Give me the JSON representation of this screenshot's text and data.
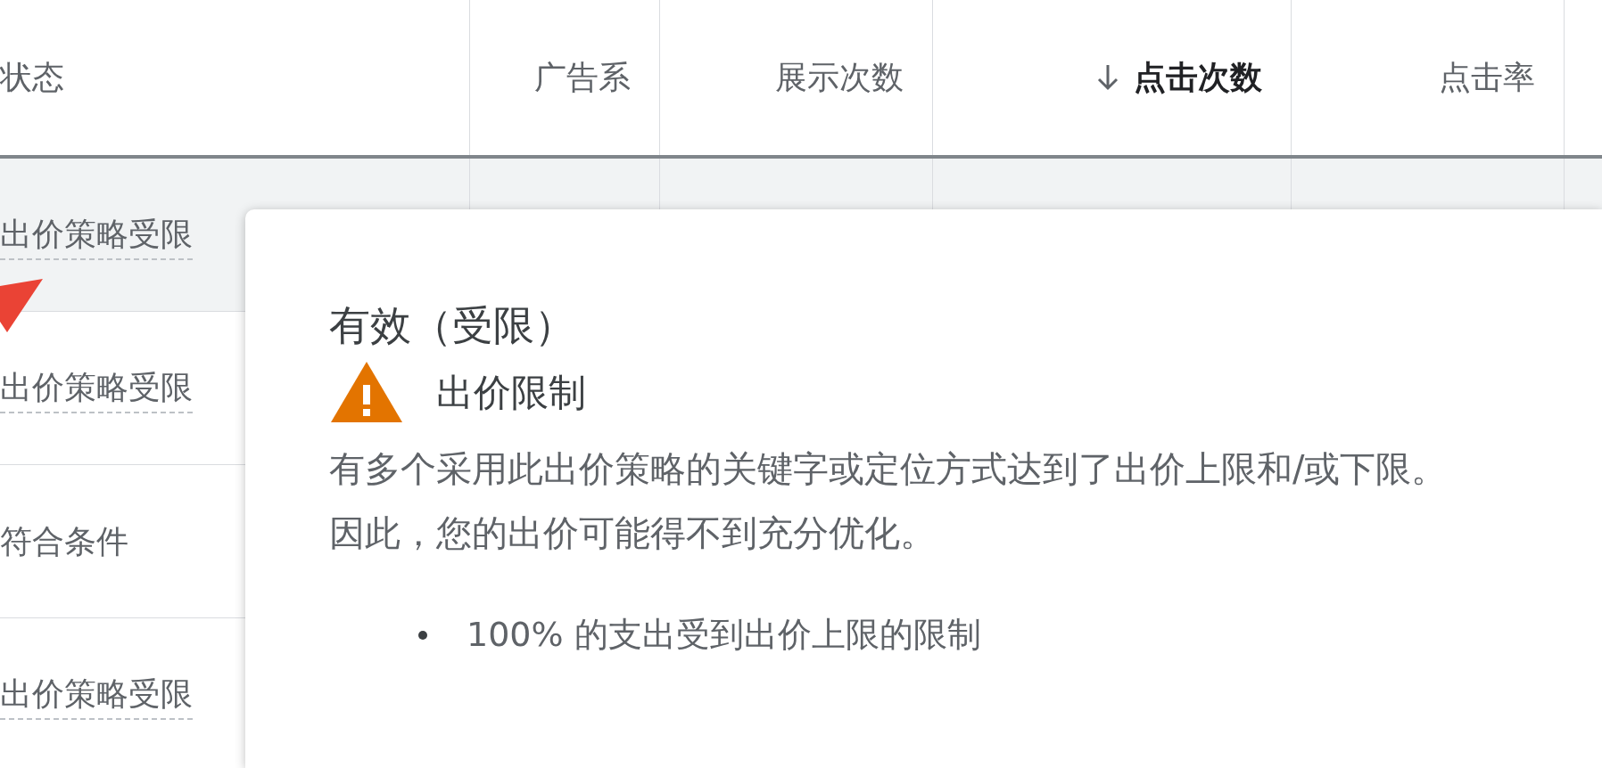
{
  "table": {
    "columns": [
      {
        "label": "状态",
        "sorted": false
      },
      {
        "label": "广告系",
        "sorted": false
      },
      {
        "label": "展示次数",
        "sorted": false
      },
      {
        "label": "点击次数",
        "sorted": true
      },
      {
        "label": "点击率",
        "sorted": false
      }
    ],
    "rows": [
      {
        "status": "出价策略受限",
        "kind": "limited",
        "hovered": true
      },
      {
        "status": "出价策略受限",
        "kind": "limited",
        "hovered": false
      },
      {
        "status": "符合条件",
        "kind": "plain",
        "hovered": false
      },
      {
        "status": "出价策略受限",
        "kind": "limited",
        "hovered": false
      }
    ]
  },
  "tooltip": {
    "title": "有效（受限）",
    "warning": "出价限制",
    "description": "有多个采用此出价策略的关键字或定位方式达到了出价上限和/或下限。因此，您的出价可能得不到充分优化。",
    "bullets": [
      "100% 的支出受到出价上限的限制"
    ]
  }
}
